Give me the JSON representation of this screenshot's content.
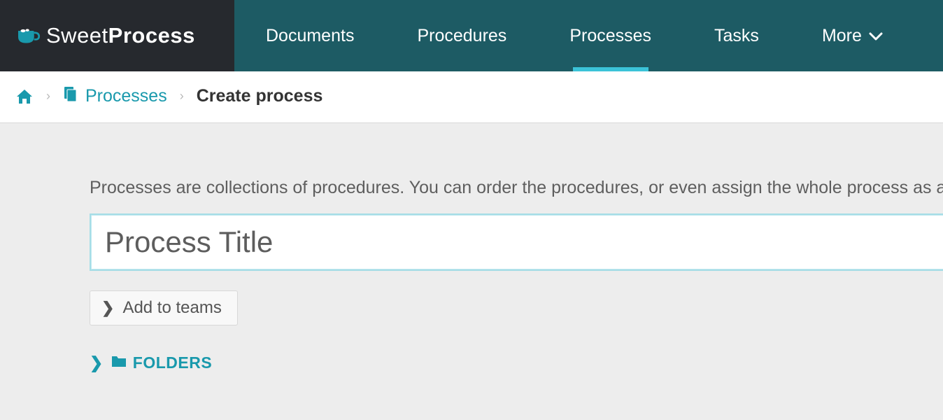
{
  "brand": {
    "name_light": "Sweet",
    "name_bold": "Process"
  },
  "nav": {
    "items": [
      {
        "label": "Documents",
        "active": false
      },
      {
        "label": "Procedures",
        "active": false
      },
      {
        "label": "Processes",
        "active": true
      },
      {
        "label": "Tasks",
        "active": false
      },
      {
        "label": "More",
        "active": false,
        "has_dropdown": true
      }
    ]
  },
  "breadcrumb": {
    "processes_label": "Processes",
    "current_label": "Create process"
  },
  "main": {
    "intro_text": "Processes are collections of procedures. You can order the procedures, or even assign the whole process as a task.",
    "title_placeholder": "Process Title",
    "title_value": "",
    "add_teams_label": "Add to teams",
    "folders_label": "FOLDERS"
  },
  "colors": {
    "accent": "#1999ac",
    "nav_bg": "#1d5b64",
    "logo_bg": "#26292e",
    "active_indicator": "#3bc3d8"
  }
}
